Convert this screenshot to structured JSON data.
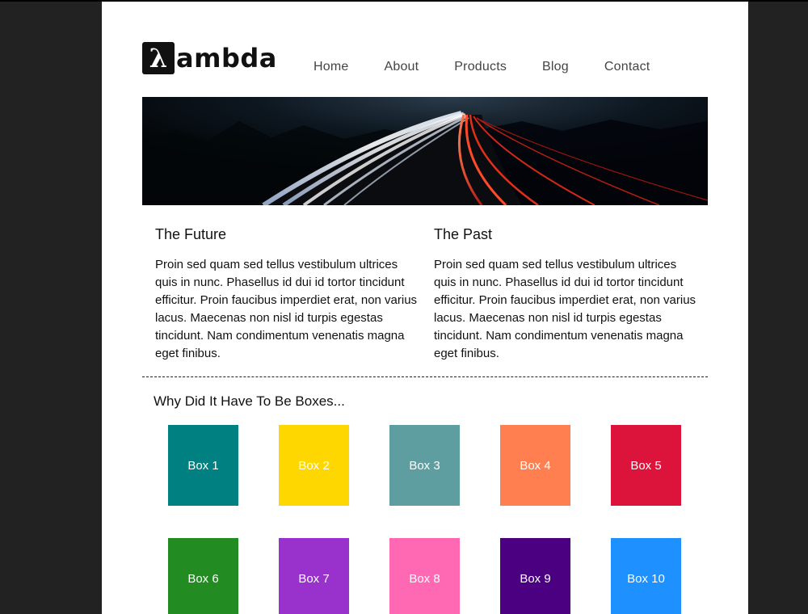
{
  "header": {
    "logo_mark": "λ",
    "logo_text": "ambda",
    "nav": [
      "Home",
      "About",
      "Products",
      "Blog",
      "Contact"
    ]
  },
  "columns": [
    {
      "title": "The Future",
      "body": "Proin sed quam sed tellus vestibulum ultrices quis in nunc. Phasellus id dui id tortor tincidunt efficitur. Proin faucibus imperdiet erat, non varius lacus. Maecenas non nisl id turpis egestas tincidunt. Nam condimentum venenatis magna eget finibus."
    },
    {
      "title": "The Past",
      "body": "Proin sed quam sed tellus vestibulum ultrices quis in nunc. Phasellus id dui id tortor tincidunt efficitur. Proin faucibus imperdiet erat, non varius lacus. Maecenas non nisl id turpis egestas tincidunt. Nam condimentum venenatis magna eget finibus."
    }
  ],
  "boxes_section": {
    "title": "Why Did It Have To Be Boxes...",
    "boxes": [
      {
        "label": "Box 1",
        "color": "#008080"
      },
      {
        "label": "Box 2",
        "color": "#FFD700"
      },
      {
        "label": "Box 3",
        "color": "#5F9EA0"
      },
      {
        "label": "Box 4",
        "color": "#FF7F50"
      },
      {
        "label": "Box 5",
        "color": "#DC143C"
      },
      {
        "label": "Box 6",
        "color": "#228B22"
      },
      {
        "label": "Box 7",
        "color": "#9932CC"
      },
      {
        "label": "Box 8",
        "color": "#FF69B4"
      },
      {
        "label": "Box 9",
        "color": "#4B0082"
      },
      {
        "label": "Box 10",
        "color": "#1E90FF"
      }
    ]
  }
}
